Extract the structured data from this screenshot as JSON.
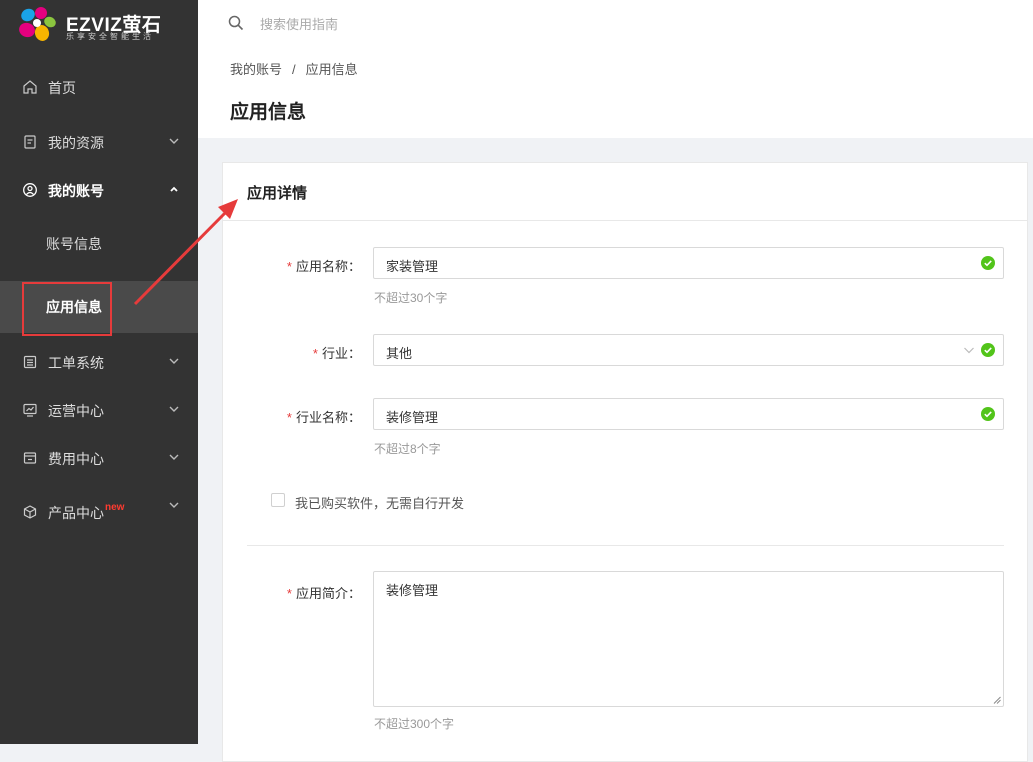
{
  "brand": {
    "name": "EZVIZ萤石",
    "slogan": "乐享安全智能生活"
  },
  "search": {
    "placeholder": "搜索使用指南"
  },
  "breadcrumb": {
    "parent": "我的账号",
    "separator": "/",
    "current": "应用信息"
  },
  "page": {
    "title": "应用信息"
  },
  "sidebar": {
    "items": [
      {
        "label": "首页",
        "icon": "home-icon"
      },
      {
        "label": "我的资源",
        "icon": "document-icon"
      },
      {
        "label": "我的账号",
        "icon": "user-circle-icon"
      },
      {
        "label": "工单系统",
        "icon": "list-icon"
      },
      {
        "label": "运营中心",
        "icon": "monitor-chart-icon"
      },
      {
        "label": "费用中心",
        "icon": "wallet-icon"
      },
      {
        "label": "产品中心",
        "icon": "cube-icon",
        "badge": "new"
      }
    ],
    "sub_items": [
      {
        "label": "账号信息"
      },
      {
        "label": "应用信息",
        "active": true
      }
    ]
  },
  "card": {
    "title": "应用详情"
  },
  "form": {
    "app_name": {
      "label": "应用名称：",
      "value": "家装管理",
      "hint": "不超过30个字"
    },
    "industry": {
      "label": "行业：",
      "value": "其他"
    },
    "industry_name": {
      "label": "行业名称：",
      "value": "装修管理",
      "hint": "不超过8个字"
    },
    "purchased_checkbox": {
      "label": "我已购买软件，无需自行开发",
      "checked": false
    },
    "app_intro": {
      "label": "应用简介：",
      "value": "装修管理",
      "hint": "不超过300个字"
    },
    "required_mark": "*"
  },
  "colors": {
    "sidebar_bg": "#333333",
    "active_bg": "#4a4a4a",
    "required": "#e63b3b",
    "success": "#52c41a",
    "annotation_red": "#e63b3b"
  }
}
